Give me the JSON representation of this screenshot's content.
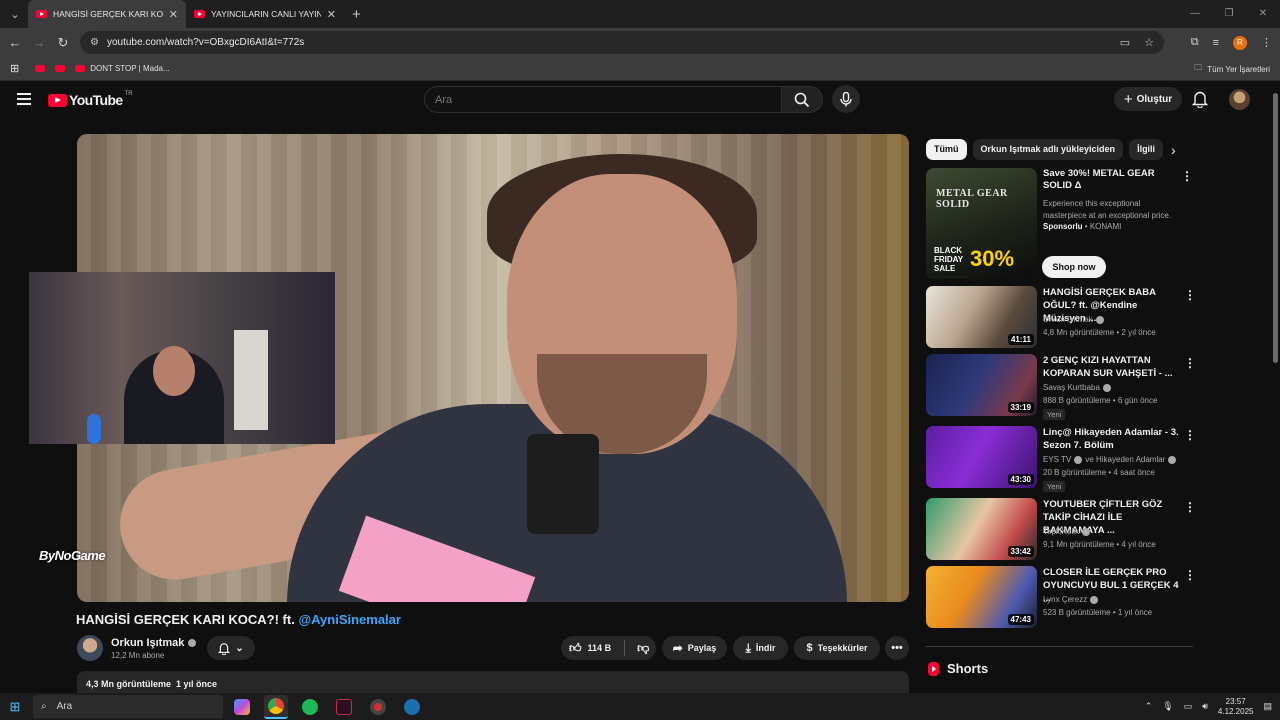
{
  "browser": {
    "tabs": [
      {
        "title": "HANGİSİ GERÇEK KARI KOCA?! ft. @AyniSinemalar",
        "active": true
      },
      {
        "title": "YAYINCILARIN CANLI YAYIN KAZALARI",
        "active": false
      }
    ],
    "url": "youtube.com/watch?v=OBxgcDI6AtI&t=772s",
    "profile_initial": "R",
    "bookmarks": [
      {
        "label": ""
      },
      {
        "label": ""
      },
      {
        "label": "DONT STOP | Mada..."
      }
    ],
    "all_bookmarks": "Tüm Yer İşaretleri"
  },
  "header": {
    "logo_text": "YouTube",
    "region": "TR",
    "search_placeholder": "Ara",
    "create_label": "Oluştur"
  },
  "player": {
    "watermark": "ByNoGame"
  },
  "video": {
    "title_text": "HANGİSİ GERÇEK KARI KOCA?! ft. ",
    "title_mention": "@AyniSinemalar",
    "channel": "Orkun Işıtmak",
    "subscribers": "12,2 Mn abone",
    "likes": "114 B",
    "share_label": "Paylaş",
    "download_label": "İndir",
    "thanks_label": "Teşekkürler",
    "views": "4,3 Mn görüntüleme",
    "age": "1 yıl önce"
  },
  "chips": [
    "Tümü",
    "Orkun Işıtmak adlı yükleyiciden",
    "İlgili"
  ],
  "ad": {
    "thumb_title": "METAL GEAR SOLID",
    "thumb_sale": "BLACK FRIDAY SALE",
    "thumb_pct": "30%",
    "title": "Save 30%! METAL GEAR SOLID Δ",
    "description": "Experience this exceptional masterpiece at an exceptional price.",
    "sponsored": "Sponsorlu",
    "advertiser": "KONAMI",
    "cta": "Shop now"
  },
  "recommendations": [
    {
      "title": "HANGİSİ GERÇEK BABA OĞUL? ft. @Kendine Müzisyen ...",
      "channel": "Orkun Işıtmak",
      "verified": true,
      "meta": "4,8 Mn görüntüleme • 2 yıl önce",
      "duration": "41:11",
      "badge": "",
      "thumb": "linear-gradient(120deg,#e9e4dc 0%,#b9a58e 40%,#5a4a3c 70%,#2c2f35 100%)"
    },
    {
      "title": "2 GENÇ KIZI HAYATTAN KOPARAN SUR VAHŞETİ - ...",
      "channel": "Savaş Kurtbaba",
      "verified": true,
      "meta": "888 B görüntüleme • 6 gün önce",
      "duration": "33:19",
      "badge": "Yeni",
      "thumb": "linear-gradient(120deg,#1b2350 0%,#2e3a7a 45%,#7a3a4a 80%,#1a1a2a 100%)"
    },
    {
      "title": "Linç@ Hikayeden Adamlar - 3. Sezon 7. Bölüm",
      "channel": "EYS TV",
      "verified": true,
      "channel2": "ve Hikayeden Adamlar",
      "meta": "20 B görüntüleme • 4 saat önce",
      "duration": "43:30",
      "badge": "Yeni",
      "thumb": "linear-gradient(120deg,#5b1fa0 0%,#8a2dd6 45%,#3b1470 100%)"
    },
    {
      "title": "YOUTUBER ÇİFTLER GÖZ TAKİP CİHAZI İLE BAKMAMAYA ...",
      "channel": "TepkiKolik",
      "verified": true,
      "meta": "9,1 Mn görüntüleme • 4 yıl önce",
      "duration": "33:42",
      "badge": "",
      "thumb": "linear-gradient(120deg,#2e9c6b 0%,#e7c6a4 45%,#c24a4a 75%,#2a2a2a 100%)"
    },
    {
      "title": "CLOSER İLE GERÇEK PRO OYUNCUYU BUL 1 GERÇEK 4 ...",
      "channel": "Lynx Çerezz",
      "verified": true,
      "meta": "523 B görüntüleme • 1 yıl önce",
      "duration": "47:43",
      "badge": "",
      "thumb": "linear-gradient(120deg,#f2b233 0%,#e98a1e 40%,#4c5bb0 75%,#1c1c2c 100%)"
    }
  ],
  "shorts_label": "Shorts",
  "taskbar": {
    "search_placeholder": "Ara",
    "time": "23:57",
    "date": "4.12.2025"
  }
}
